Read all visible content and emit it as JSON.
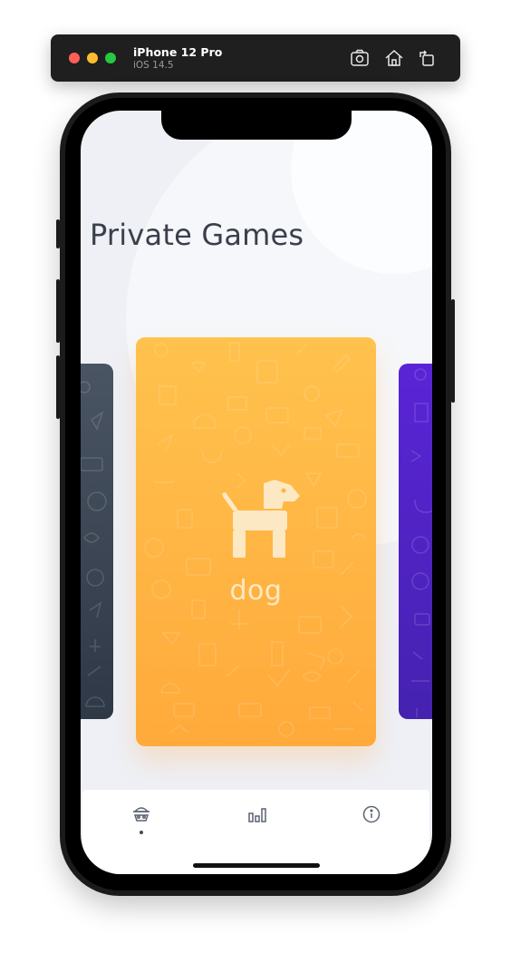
{
  "simulator": {
    "device_name": "iPhone 12 Pro",
    "os_version": "iOS 14.5",
    "buttons": [
      "screenshot-icon",
      "home-icon",
      "rotate-icon"
    ]
  },
  "app": {
    "page_title": "Private Games",
    "cards": [
      {
        "name": "left-card",
        "color": "#3a4554"
      },
      {
        "name": "main-card",
        "label": "dog",
        "icon": "dog-icon",
        "color": "#ffb443"
      },
      {
        "name": "right-card",
        "color": "#5322c8"
      }
    ],
    "tabs": [
      {
        "icon": "games-icon",
        "active": true
      },
      {
        "icon": "stats-icon",
        "active": false
      },
      {
        "icon": "info-icon",
        "active": false
      }
    ]
  }
}
